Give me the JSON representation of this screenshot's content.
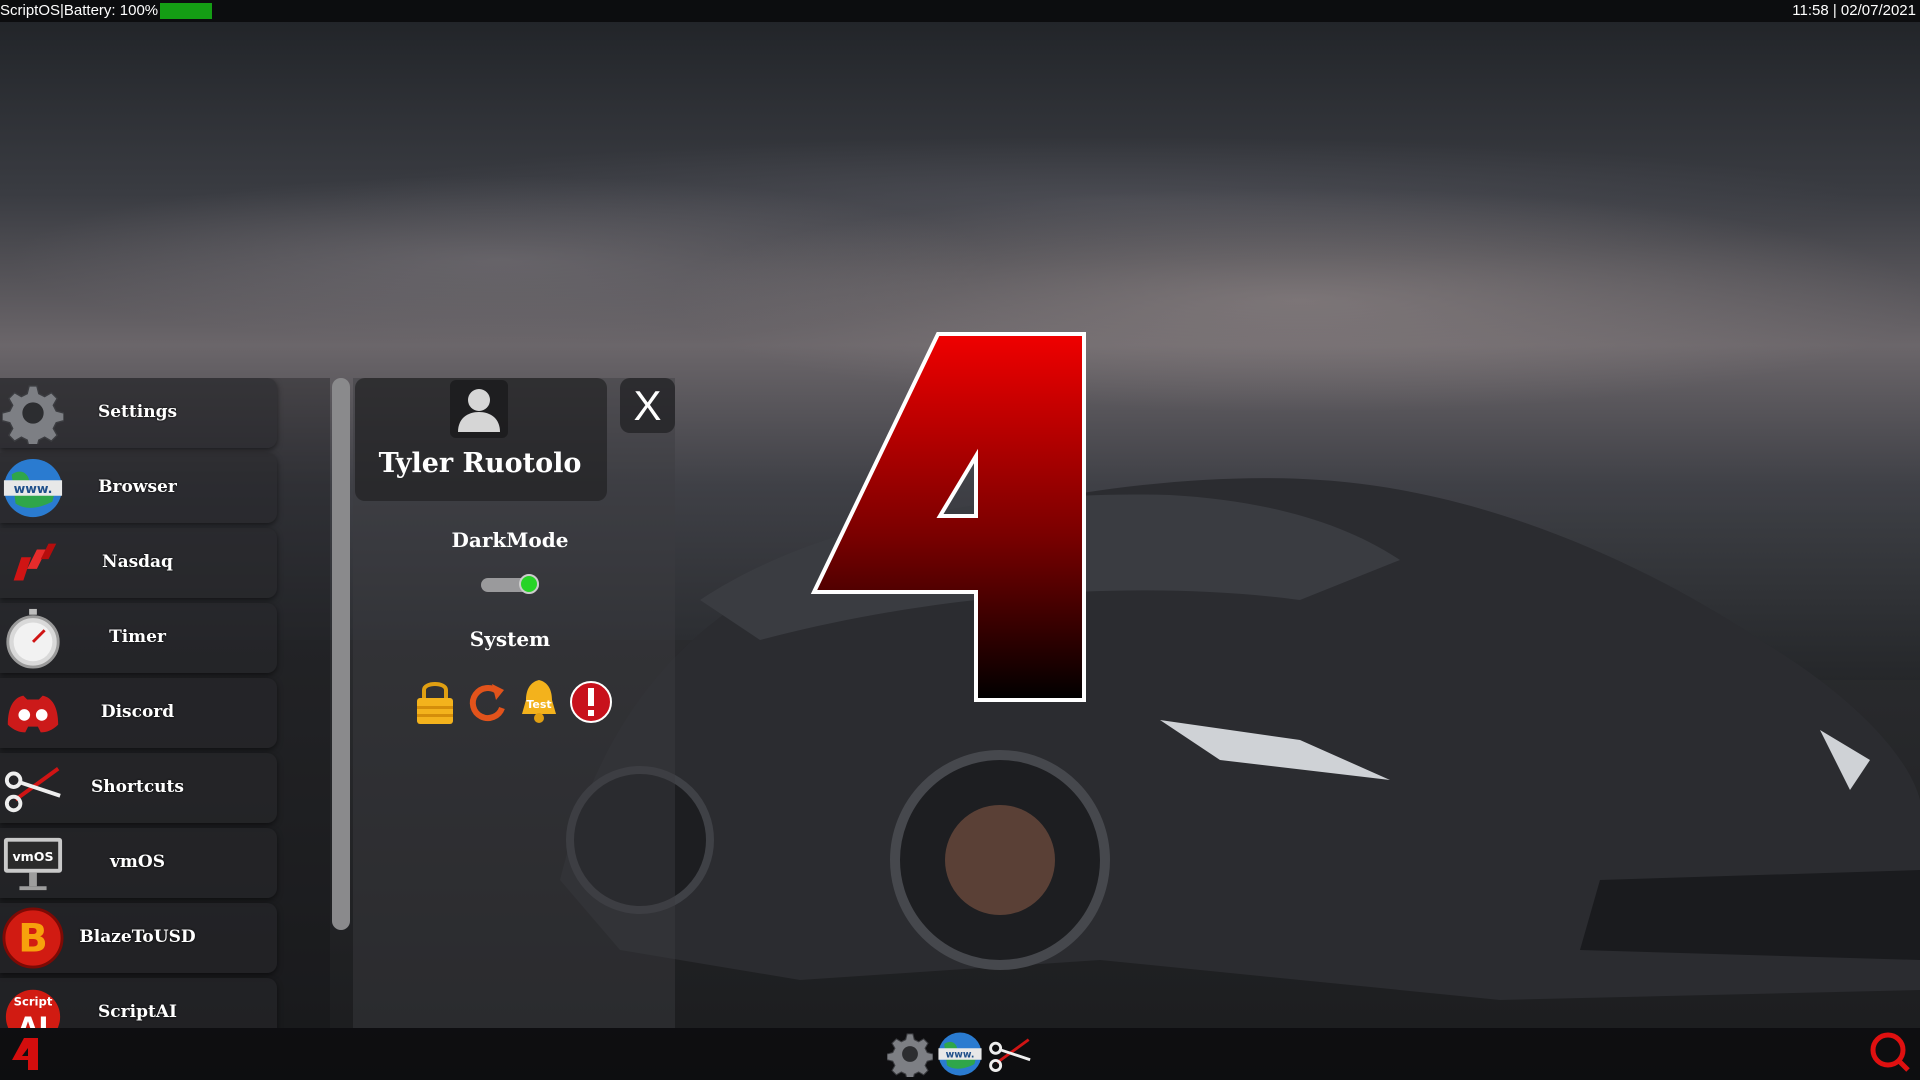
{
  "topbar": {
    "status_text": "ScriptOS|Battery: 100%",
    "battery_level": 1.0,
    "battery_color": "#149d14",
    "clock": "11:58 | 02/07/2021"
  },
  "apps": [
    {
      "label": "Settings",
      "icon": "gear-icon"
    },
    {
      "label": "Browser",
      "icon": "globe-www-icon"
    },
    {
      "label": "Nasdaq",
      "icon": "nasdaq-icon"
    },
    {
      "label": "Timer",
      "icon": "stopwatch-icon"
    },
    {
      "label": "Discord",
      "icon": "discord-icon"
    },
    {
      "label": "Shortcuts",
      "icon": "scissors-icon"
    },
    {
      "label": "vmOS",
      "icon": "vmos-monitor-icon"
    },
    {
      "label": "BlazeToUSD",
      "icon": "blaze-b-icon"
    },
    {
      "label": "ScriptAI",
      "icon": "script-ai-icon"
    }
  ],
  "user_panel": {
    "username": "Tyler Ruotolo",
    "close_label": "X",
    "darkmode_label": "DarkMode",
    "darkmode_on": true,
    "system_label": "System",
    "system_buttons": [
      "lock-icon",
      "restart-icon",
      "test-bell-icon",
      "alert-icon"
    ],
    "test_text": "Test"
  },
  "branding": {
    "logo_glyph": "4",
    "accent_color": "#e00000"
  },
  "dock": {
    "start_glyph": "4",
    "pinned": [
      "gear-icon",
      "globe-www-icon",
      "scissors-icon"
    ],
    "search_icon": "search-ring-icon"
  }
}
